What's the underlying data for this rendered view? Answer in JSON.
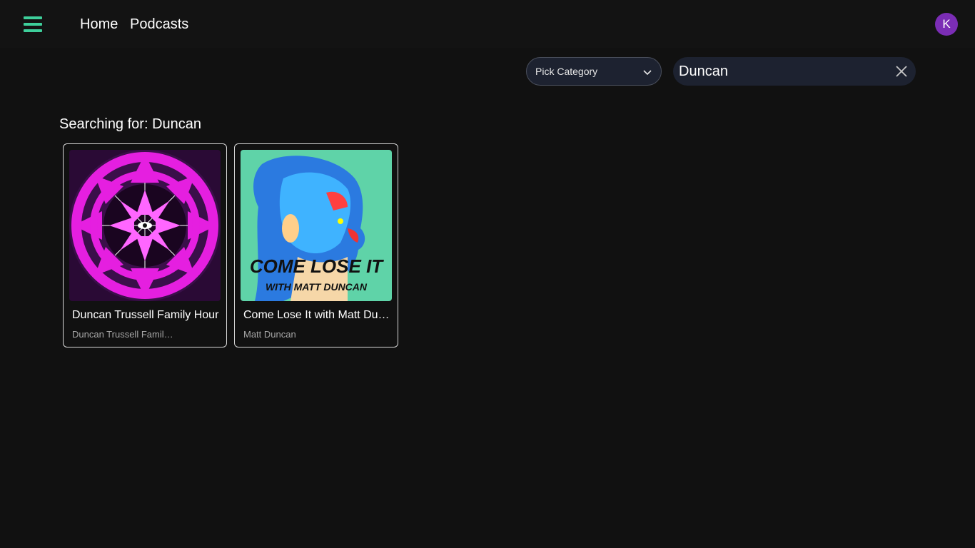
{
  "header": {
    "nav": {
      "home": "Home",
      "podcasts": "Podcasts"
    },
    "avatar_initial": "K",
    "accent_color": "#3ecf9b",
    "avatar_color": "#7b2db5"
  },
  "filters": {
    "category_label": "Pick Category",
    "search_value": "Duncan"
  },
  "results": {
    "heading": "Searching for: Duncan",
    "items": [
      {
        "title": "Duncan Trussell Family Hour",
        "author": "Duncan Trussell Family Hour",
        "art": "psychedelic-mandala-artwork"
      },
      {
        "title": "Come Lose It with Matt Duncan",
        "author": "Matt Duncan",
        "art": "come-lose-it-artwork",
        "art_text_1": "COME LOSE IT",
        "art_text_2": "WITH MATT DUNCAN"
      }
    ]
  }
}
